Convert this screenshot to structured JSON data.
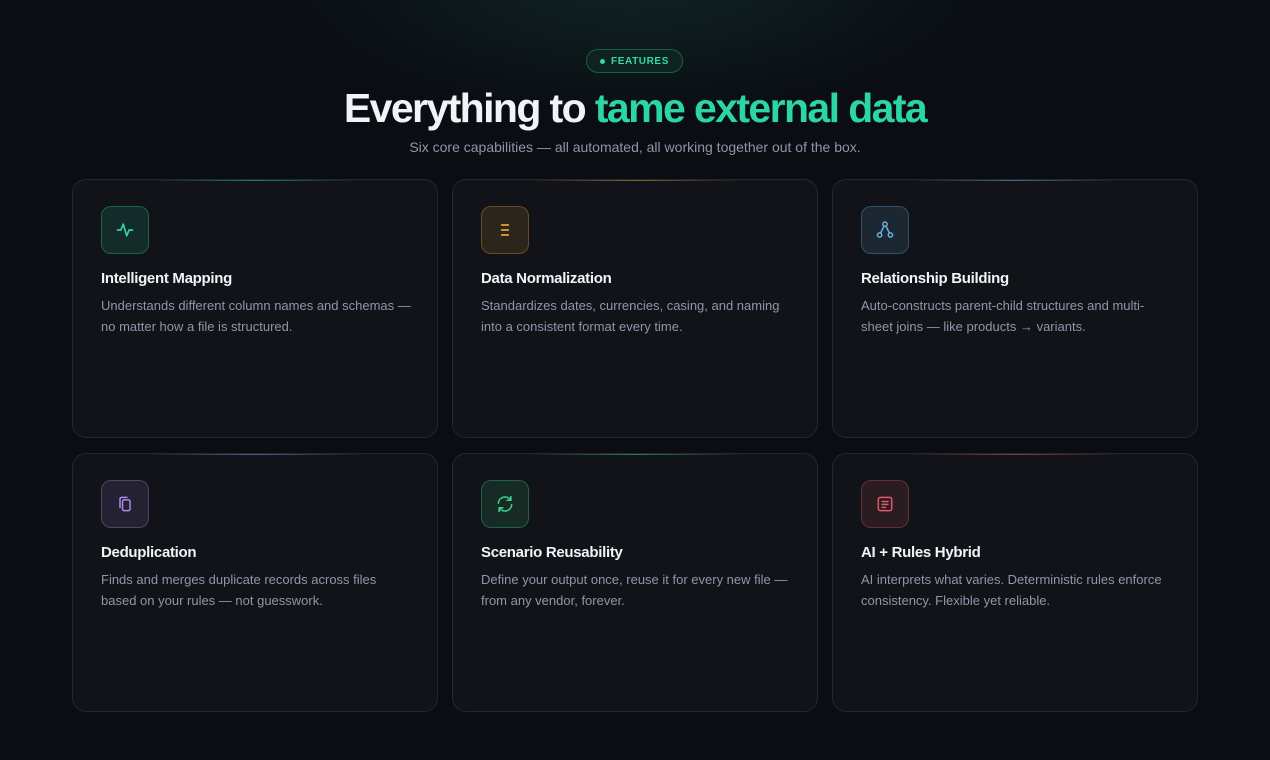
{
  "badge": {
    "label": "FEATURES"
  },
  "headline": {
    "plain": "Everything to ",
    "accent": "tame external data"
  },
  "subtitle": "Six core capabilities — all automated, all working together out of the box.",
  "colors": {
    "background": "#0a0d12",
    "card": "#111318",
    "accent": "#2bd6a3"
  },
  "features": [
    {
      "title": "Intelligent Mapping",
      "description": "Understands different column names and schemas — no matter how a file is structured.",
      "icon": "activity-icon",
      "color": "#2bd6a3"
    },
    {
      "title": "Data Normalization",
      "description": "Standardizes dates, currencies, casing, and naming into a consistent format every time.",
      "icon": "list-icon",
      "color": "#e8a03a"
    },
    {
      "title": "Relationship Building",
      "description": "Auto-constructs parent-child structures and multi-sheet joins — like products → variants.",
      "icon": "hierarchy-icon",
      "color": "#6aaee0"
    },
    {
      "title": "Deduplication",
      "description": "Finds and merges duplicate records across files based on your rules — not guesswork.",
      "icon": "copy-icon",
      "color": "#a98ae6"
    },
    {
      "title": "Scenario Reusability",
      "description": "Define your output once, reuse it for every new file — from any vendor, forever.",
      "icon": "refresh-icon",
      "color": "#3fcf8e"
    },
    {
      "title": "AI + Rules Hybrid",
      "description": "AI interprets what varies. Deterministic rules enforce consistency. Flexible yet reliable.",
      "icon": "document-icon",
      "color": "#e05a6a"
    }
  ]
}
